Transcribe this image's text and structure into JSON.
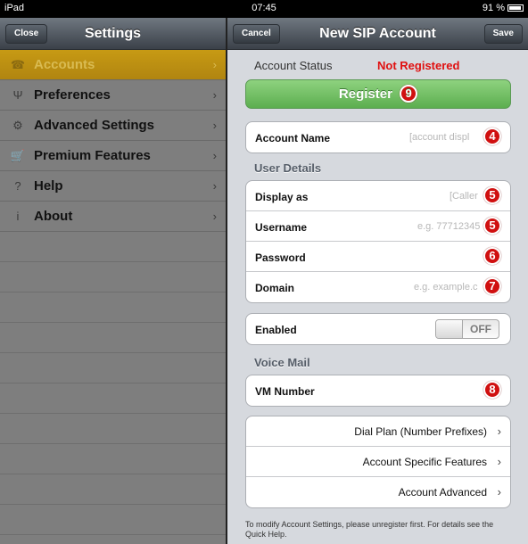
{
  "status_bar": {
    "device": "iPad",
    "time": "07:45",
    "battery": "91 %"
  },
  "left": {
    "title": "Settings",
    "close_label": "Close",
    "items": [
      {
        "label": "Accounts",
        "icon": "phone-icon",
        "glyph": "☎",
        "selected": true
      },
      {
        "label": "Preferences",
        "icon": "cutlery-icon",
        "glyph": "Ψ",
        "selected": false
      },
      {
        "label": "Advanced Settings",
        "icon": "gears-icon",
        "glyph": "⚙",
        "selected": false
      },
      {
        "label": "Premium Features",
        "icon": "cart-icon",
        "glyph": "🛒",
        "selected": false
      },
      {
        "label": "Help",
        "icon": "help-icon",
        "glyph": "?",
        "selected": false
      },
      {
        "label": "About",
        "icon": "info-icon",
        "glyph": "i",
        "selected": false
      }
    ]
  },
  "right": {
    "title": "New SIP Account",
    "cancel_label": "Cancel",
    "save_label": "Save",
    "account_status_label": "Account Status",
    "account_status_value": "Not Registered",
    "status_color": "#e01010",
    "register_label": "Register",
    "register_badge": "9",
    "account_name": {
      "label": "Account Name",
      "placeholder": "[account displ",
      "badge": "4"
    },
    "user_details_title": "User Details",
    "user_rows": [
      {
        "label": "Display as",
        "placeholder": "[Caller",
        "badge": "5"
      },
      {
        "label": "Username",
        "placeholder": "e.g. 77712345",
        "badge": "5"
      },
      {
        "label": "Password",
        "placeholder": "",
        "badge": "6"
      },
      {
        "label": "Domain",
        "placeholder": "e.g. example.c",
        "badge": "7"
      }
    ],
    "enabled": {
      "label": "Enabled",
      "state": "OFF"
    },
    "voice_mail_title": "Voice Mail",
    "vm": {
      "label": "VM Number",
      "badge": "8"
    },
    "links": [
      {
        "label": "Dial Plan (Number Prefixes)"
      },
      {
        "label": "Account Specific Features"
      },
      {
        "label": "Account Advanced"
      }
    ],
    "footer_note": "To modify Account Settings, please unregister first.  For details see the Quick Help."
  }
}
